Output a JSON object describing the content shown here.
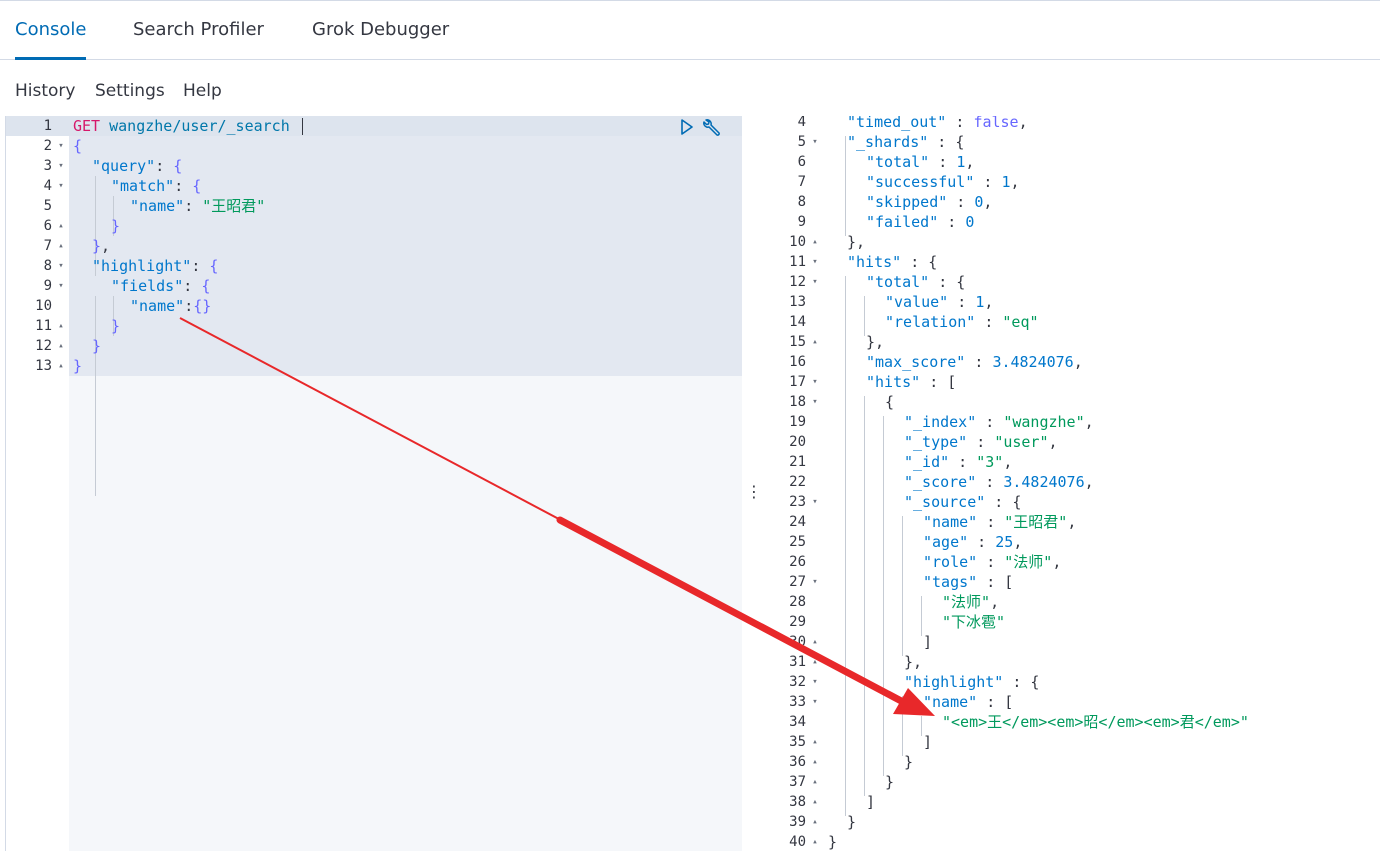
{
  "tabs": [
    {
      "label": "Console",
      "active": true
    },
    {
      "label": "Search Profiler",
      "active": false
    },
    {
      "label": "Grok Debugger",
      "active": false
    }
  ],
  "menu": [
    "History",
    "Settings",
    "Help"
  ],
  "request": {
    "method": "GET",
    "url": "wangzhe/user/_search",
    "lines": [
      {
        "n": "1",
        "fold": ""
      },
      {
        "n": "2",
        "fold": "▾"
      },
      {
        "n": "3",
        "fold": "▾"
      },
      {
        "n": "4",
        "fold": "▾"
      },
      {
        "n": "5",
        "fold": ""
      },
      {
        "n": "6",
        "fold": "▴"
      },
      {
        "n": "7",
        "fold": "▴"
      },
      {
        "n": "8",
        "fold": "▾"
      },
      {
        "n": "9",
        "fold": "▾"
      },
      {
        "n": "10",
        "fold": ""
      },
      {
        "n": "11",
        "fold": "▴"
      },
      {
        "n": "12",
        "fold": "▴"
      },
      {
        "n": "13",
        "fold": "▴"
      }
    ],
    "text": {
      "l2": "{",
      "query": "\"query\"",
      "match": "\"match\"",
      "name_key": "\"name\"",
      "name_val": "\"王昭君\"",
      "highlight": "\"highlight\"",
      "fields": "\"fields\"",
      "name_key2": "\"name\""
    }
  },
  "response": {
    "lines": [
      {
        "n": "4",
        "fold": ""
      },
      {
        "n": "5",
        "fold": "▾"
      },
      {
        "n": "6",
        "fold": ""
      },
      {
        "n": "7",
        "fold": ""
      },
      {
        "n": "8",
        "fold": ""
      },
      {
        "n": "9",
        "fold": ""
      },
      {
        "n": "10",
        "fold": "▴"
      },
      {
        "n": "11",
        "fold": "▾"
      },
      {
        "n": "12",
        "fold": "▾"
      },
      {
        "n": "13",
        "fold": ""
      },
      {
        "n": "14",
        "fold": ""
      },
      {
        "n": "15",
        "fold": "▴"
      },
      {
        "n": "16",
        "fold": ""
      },
      {
        "n": "17",
        "fold": "▾"
      },
      {
        "n": "18",
        "fold": "▾"
      },
      {
        "n": "19",
        "fold": ""
      },
      {
        "n": "20",
        "fold": ""
      },
      {
        "n": "21",
        "fold": ""
      },
      {
        "n": "22",
        "fold": ""
      },
      {
        "n": "23",
        "fold": "▾"
      },
      {
        "n": "24",
        "fold": ""
      },
      {
        "n": "25",
        "fold": ""
      },
      {
        "n": "26",
        "fold": ""
      },
      {
        "n": "27",
        "fold": "▾"
      },
      {
        "n": "28",
        "fold": ""
      },
      {
        "n": "29",
        "fold": ""
      },
      {
        "n": "30",
        "fold": "▴"
      },
      {
        "n": "31",
        "fold": "▴"
      },
      {
        "n": "32",
        "fold": "▾"
      },
      {
        "n": "33",
        "fold": "▾"
      },
      {
        "n": "34",
        "fold": ""
      },
      {
        "n": "35",
        "fold": "▴"
      },
      {
        "n": "36",
        "fold": "▴"
      },
      {
        "n": "37",
        "fold": "▴"
      },
      {
        "n": "38",
        "fold": "▴"
      },
      {
        "n": "39",
        "fold": "▴"
      },
      {
        "n": "40",
        "fold": "▴"
      }
    ],
    "text": {
      "timed_out": "\"timed_out\"",
      "timed_out_val": "false",
      "shards": "\"_shards\"",
      "total": "\"total\"",
      "total_val": "1",
      "successful": "\"successful\"",
      "successful_val": "1",
      "skipped": "\"skipped\"",
      "skipped_val": "0",
      "failed": "\"failed\"",
      "failed_val": "0",
      "hits": "\"hits\"",
      "hits_total": "\"total\"",
      "value": "\"value\"",
      "value_val": "1",
      "relation": "\"relation\"",
      "relation_val": "\"eq\"",
      "max_score": "\"max_score\"",
      "max_score_val": "3.4824076",
      "hits_arr": "\"hits\"",
      "index": "\"_index\"",
      "index_val": "\"wangzhe\"",
      "type": "\"_type\"",
      "type_val": "\"user\"",
      "id": "\"_id\"",
      "id_val": "\"3\"",
      "score": "\"_score\"",
      "score_val": "3.4824076",
      "source": "\"_source\"",
      "src_name": "\"name\"",
      "src_name_val": "\"王昭君\"",
      "age": "\"age\"",
      "age_val": "25",
      "role": "\"role\"",
      "role_val": "\"法师\"",
      "tags": "\"tags\"",
      "tag1": "\"法师\"",
      "tag2": "\"下冰雹\"",
      "highlight": "\"highlight\"",
      "hl_name": "\"name\"",
      "hl_val": "\"<em>王</em><em>昭</em><em>君</em>\""
    }
  },
  "colors": {
    "accent": "#006bb4",
    "arrow": "#e8282a"
  }
}
